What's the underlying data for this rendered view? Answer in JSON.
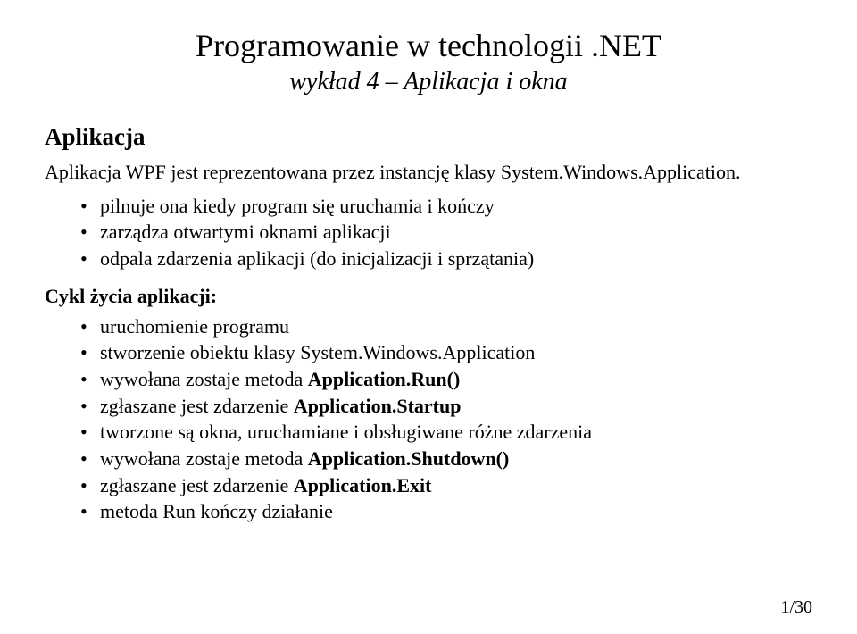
{
  "header": {
    "title": "Programowanie w technologii .NET",
    "subtitle": "wykład 4 – Aplikacja i okna"
  },
  "section1": {
    "heading": "Aplikacja",
    "intro": "Aplikacja WPF jest reprezentowana przez instancję klasy System.Windows.Application.",
    "bullets": [
      "pilnuje ona kiedy program się uruchamia i kończy",
      "zarządza otwartymi oknami aplikacji",
      "odpala zdarzenia aplikacji (do inicjalizacji i sprzątania)"
    ]
  },
  "section2": {
    "heading": "Cykl życia aplikacji:",
    "bullets": [
      {
        "text": "uruchomienie programu"
      },
      {
        "text": "stworzenie obiektu klasy System.Windows.Application"
      },
      {
        "pre": "wywołana zostaje metoda ",
        "bold": "Application.Run()"
      },
      {
        "pre": "zgłaszane jest zdarzenie ",
        "bold": "Application.Startup"
      },
      {
        "text": "tworzone są okna, uruchamiane i obsługiwane różne zdarzenia"
      },
      {
        "pre": "wywołana zostaje metoda ",
        "bold": "Application.Shutdown()"
      },
      {
        "pre": "zgłaszane jest zdarzenie ",
        "bold": "Application.Exit"
      },
      {
        "text": "metoda Run kończy działanie"
      }
    ]
  },
  "pageNumber": "1/30"
}
